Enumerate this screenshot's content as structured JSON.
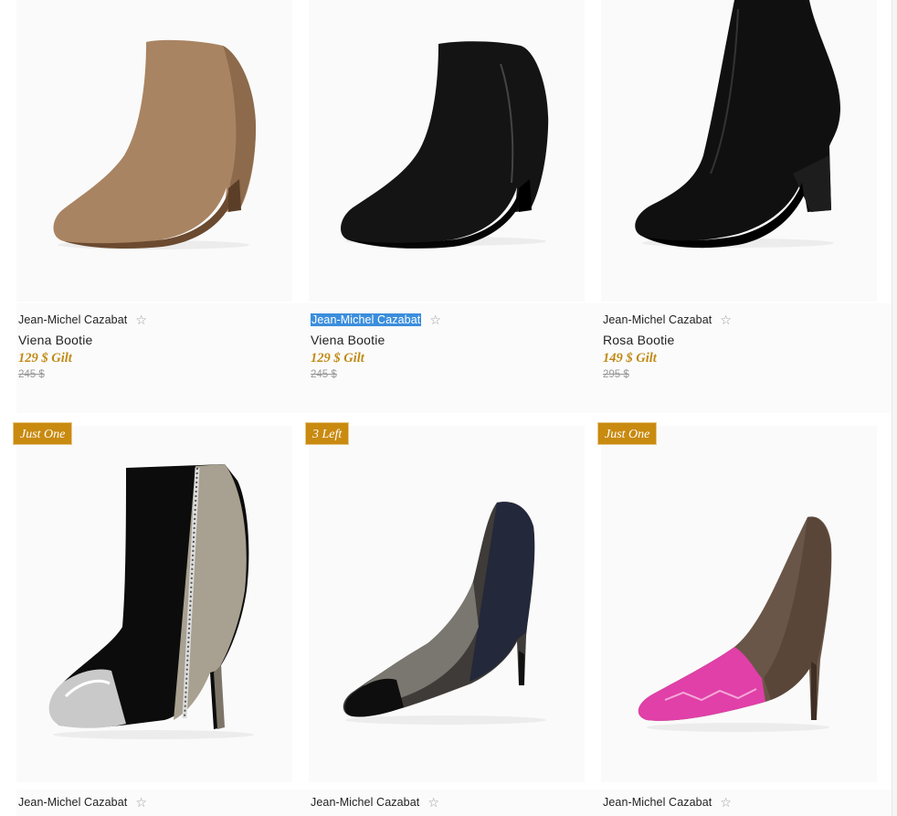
{
  "colors": {
    "price": "#c08a15",
    "badge": "#c98a10",
    "selection": "#3b8edc"
  },
  "icons": {
    "favorite": "star-outline-icon"
  },
  "products": [
    {
      "brand": "Jean-Michel Cazabat",
      "name": "Viena Bootie",
      "price": "129 $ Gilt",
      "original_price": "245 $"
    },
    {
      "brand": "Jean-Michel Cazabat",
      "name": "Viena Bootie",
      "price": "129 $ Gilt",
      "original_price": "245 $"
    },
    {
      "brand": "Jean-Michel Cazabat",
      "name": "Rosa Bootie",
      "price": "149 $ Gilt",
      "original_price": "295 $"
    },
    {
      "brand": "Jean-Michel Cazabat",
      "badge": "Just One"
    },
    {
      "brand": "Jean-Michel Cazabat",
      "badge": "3 Left"
    },
    {
      "brand": "Jean-Michel Cazabat",
      "badge": "Just One"
    }
  ]
}
